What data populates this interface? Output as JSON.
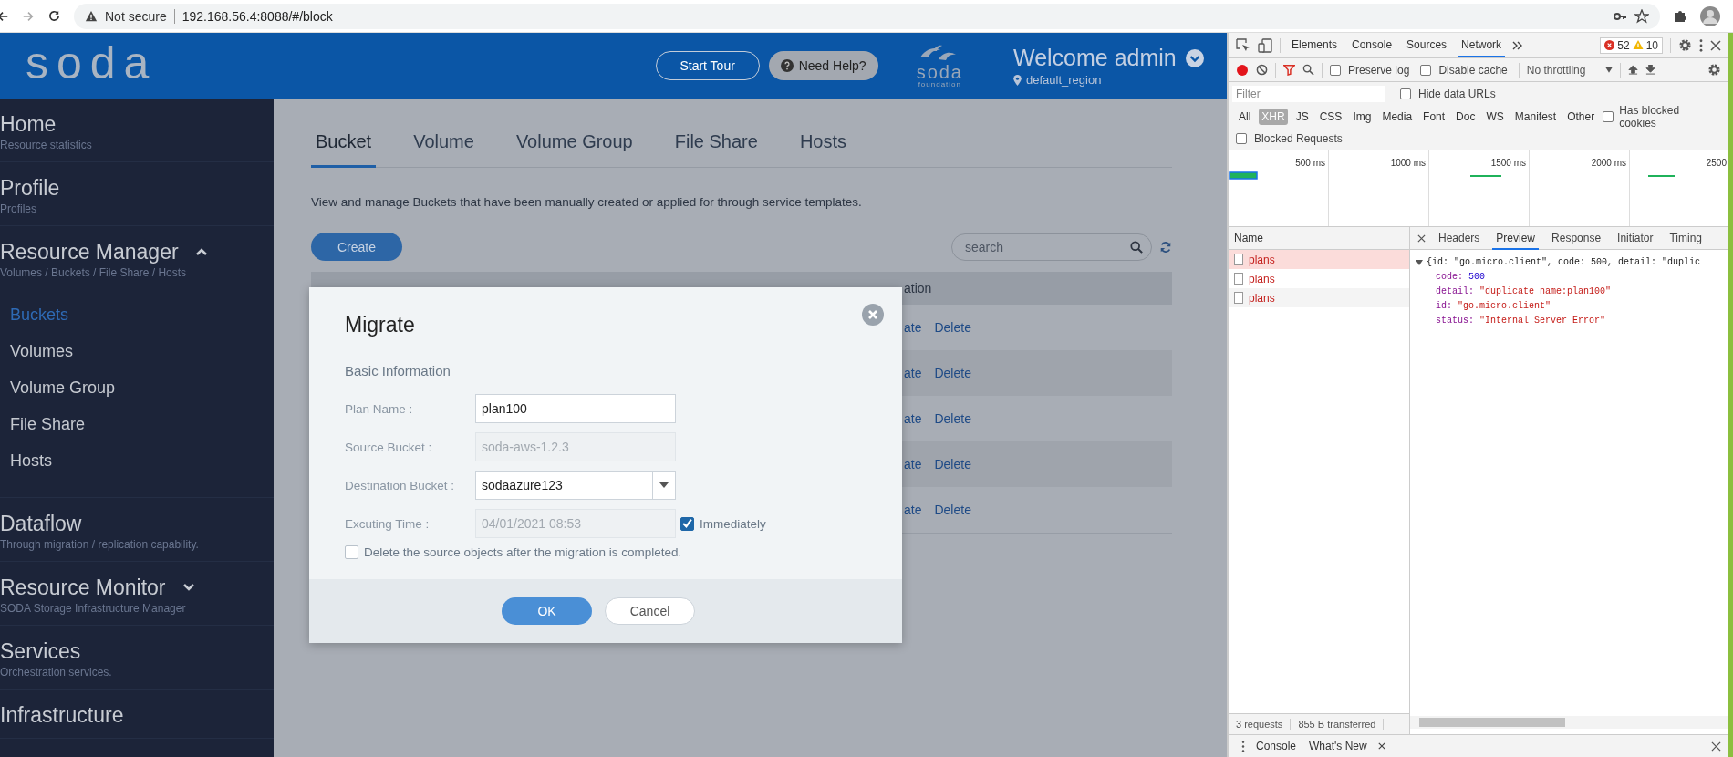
{
  "browser": {
    "security_label": "Not secure",
    "url": "192.168.56.4:8088/#/block"
  },
  "header": {
    "logo": "soda",
    "start_tour": "Start Tour",
    "need_help": "Need Help?",
    "foundation_name": "soda",
    "foundation_tagline": "foundation",
    "welcome": "Welcome admin",
    "region": "default_region"
  },
  "sidebar": [
    {
      "kind": "section",
      "label": "Home",
      "subtitle": "Resource statistics"
    },
    {
      "kind": "section",
      "label": "Profile",
      "subtitle": "Profiles"
    },
    {
      "kind": "group",
      "label": "Resource Manager",
      "subtitle": "Volumes / Buckets / File Share / Hosts",
      "expanded": true,
      "children": [
        {
          "label": "Buckets",
          "selected": true
        },
        {
          "label": "Volumes",
          "selected": false
        },
        {
          "label": "Volume Group",
          "selected": false
        },
        {
          "label": "File Share",
          "selected": false
        },
        {
          "label": "Hosts",
          "selected": false
        }
      ]
    },
    {
      "kind": "section",
      "label": "Dataflow",
      "subtitle": "Through migration / replication capability."
    },
    {
      "kind": "group",
      "label": "Resource Monitor",
      "subtitle": "SODA Storage Infrastructure Manager",
      "expanded": false
    },
    {
      "kind": "section",
      "label": "Services",
      "subtitle": "Orchestration services."
    },
    {
      "kind": "section",
      "label": "Infrastructure"
    }
  ],
  "tabs": [
    {
      "label": "Bucket",
      "selected": true
    },
    {
      "label": "Volume",
      "selected": false
    },
    {
      "label": "Volume Group",
      "selected": false
    },
    {
      "label": "File Share",
      "selected": false
    },
    {
      "label": "Hosts",
      "selected": false
    }
  ],
  "description": "View and manage Buckets that have been manually created or applied for through service templates.",
  "create_button": "Create",
  "search": {
    "placeholder": "search"
  },
  "table": {
    "columns": [
      "ation"
    ],
    "rows": [
      {
        "cells": [
          "ate",
          "Delete"
        ]
      },
      {
        "cells": [
          "ate",
          "Delete"
        ]
      },
      {
        "cells": [
          "ate",
          "Delete"
        ]
      },
      {
        "cells": [
          "ate",
          "Delete"
        ]
      },
      {
        "cells": [
          "ate",
          "Delete"
        ]
      }
    ]
  },
  "modal": {
    "title": "Migrate",
    "section": "Basic Information",
    "fields": [
      {
        "kind": "text",
        "label": "Plan Name :",
        "value": "plan100",
        "disabled": false
      },
      {
        "kind": "text",
        "label": "Source Bucket :",
        "value": "soda-aws-1.2.3",
        "disabled": true
      },
      {
        "kind": "select",
        "label": "Destination Bucket :",
        "value": "sodaazure123"
      },
      {
        "kind": "text",
        "label": "Excuting Time :",
        "value": "04/01/2021 08:53",
        "disabled": true,
        "option": {
          "label": "Immediately",
          "checked": true
        }
      }
    ],
    "delete_option": {
      "label": "Delete the source objects after the migration is completed.",
      "checked": false
    },
    "ok": "OK",
    "cancel": "Cancel"
  },
  "devtools": {
    "tabs": [
      {
        "label": "Elements",
        "selected": false
      },
      {
        "label": "Console",
        "selected": false
      },
      {
        "label": "Sources",
        "selected": false
      },
      {
        "label": "Network",
        "selected": true
      }
    ],
    "errors": "52",
    "warnings": "10",
    "recording": true,
    "checkboxes": [
      {
        "label": "Preserve log",
        "checked": false
      },
      {
        "label": "Disable cache",
        "checked": false
      }
    ],
    "throttling": "No throttling",
    "filter": {
      "placeholder": "Filter"
    },
    "hide_data_urls": {
      "label": "Hide data URLs",
      "checked": false
    },
    "types": [
      {
        "label": "All",
        "selected": false
      },
      {
        "label": "XHR",
        "selected": true
      },
      {
        "label": "JS",
        "selected": false
      },
      {
        "label": "CSS",
        "selected": false
      },
      {
        "label": "Img",
        "selected": false
      },
      {
        "label": "Media",
        "selected": false
      },
      {
        "label": "Font",
        "selected": false
      },
      {
        "label": "Doc",
        "selected": false
      },
      {
        "label": "WS",
        "selected": false
      },
      {
        "label": "Manifest",
        "selected": false
      },
      {
        "label": "Other",
        "selected": false
      }
    ],
    "blocked_cookies": {
      "label": "Has blocked cookies",
      "checked": false
    },
    "blocked_requests": {
      "label": "Blocked Requests",
      "checked": false
    },
    "ticks": [
      "500 ms",
      "1000 ms",
      "1500 ms",
      "2000 ms",
      "2500"
    ],
    "name_header": "Name",
    "requests": [
      {
        "name": "plans",
        "selected": true
      },
      {
        "name": "plans",
        "selected": false
      },
      {
        "name": "plans",
        "selected": false
      }
    ],
    "detail_tabs": [
      {
        "label": "Headers",
        "selected": false
      },
      {
        "label": "Preview",
        "selected": true
      },
      {
        "label": "Response",
        "selected": false
      },
      {
        "label": "Initiator",
        "selected": false
      },
      {
        "label": "Timing",
        "selected": false
      }
    ],
    "preview_summary": "{id: \"go.micro.client\", code: 500, detail: \"duplic",
    "preview_fields": [
      {
        "key": "code:",
        "value": "500",
        "kind": "number"
      },
      {
        "key": "detail:",
        "value": "\"duplicate name:plan100\"",
        "kind": "string"
      },
      {
        "key": "id:",
        "value": "\"go.micro.client\"",
        "kind": "string"
      },
      {
        "key": "status:",
        "value": "\"Internal Server Error\"",
        "kind": "string"
      }
    ],
    "status": [
      "3 requests",
      "855 B transferred"
    ],
    "drawer_tabs": [
      {
        "label": "Console",
        "closable": false
      },
      {
        "label": "What's New",
        "closable": true
      }
    ]
  }
}
